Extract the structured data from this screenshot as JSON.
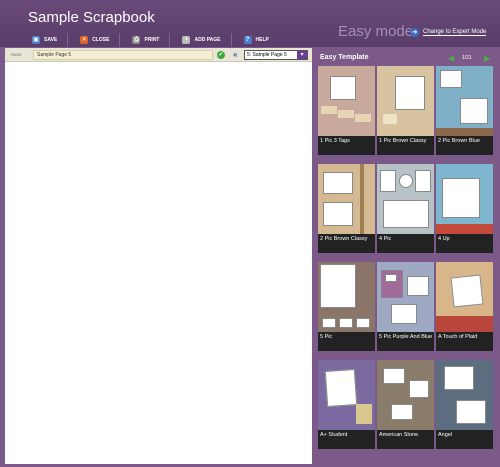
{
  "app": {
    "title": "Sample Scrapbook",
    "mode": "Easy mode",
    "expert_label": "Change to Expert Mode"
  },
  "toolbar": [
    {
      "label": "SAVE",
      "icon": "save-icon",
      "color": "#4b7fcb"
    },
    {
      "label": "CLOSE",
      "icon": "close-icon",
      "color": "#d9652b"
    },
    {
      "label": "PRINT",
      "icon": "print-icon",
      "color": "#8b8b8b"
    },
    {
      "label": "ADD PAGE",
      "icon": "add-page-icon",
      "color": "#bbbbbb"
    },
    {
      "label": "HELP",
      "icon": "help-icon",
      "color": "#4b7fcb"
    }
  ],
  "page_bar": {
    "label": "PAGE",
    "value": "Sample Page 5",
    "selected": "5: Sample Page 5"
  },
  "templates_panel": {
    "title": "Easy Template",
    "page_indicator": "1/21",
    "templates": [
      {
        "name": "1 Pic 3 Tags",
        "bg": "#c9a99b"
      },
      {
        "name": "1 Pic Brown Classy",
        "bg": "#d8c3a0"
      },
      {
        "name": "2 Pic Brown Blue",
        "bg": "#7fb0c7"
      },
      {
        "name": "2 Pic Brown Classy",
        "bg": "#d5b992"
      },
      {
        "name": "4 Pic",
        "bg": "#b7c2c6"
      },
      {
        "name": "4 Up",
        "bg": "#7fb5cf"
      },
      {
        "name": "5 Pic",
        "bg": "#8a7568"
      },
      {
        "name": "5 Pic Purple And Blue",
        "bg": "#9fa9c4"
      },
      {
        "name": "A Touch of Plaid",
        "bg": "#d9b58a"
      },
      {
        "name": "A+ Student",
        "bg": "#7b6aa0"
      },
      {
        "name": "American Stone",
        "bg": "#8a7c6a"
      },
      {
        "name": "Angel",
        "bg": "#5c6d7f"
      }
    ]
  },
  "colors": {
    "header": "#5a3d6a",
    "panel": "#7b5a8a",
    "accent": "#6a3c9c"
  }
}
